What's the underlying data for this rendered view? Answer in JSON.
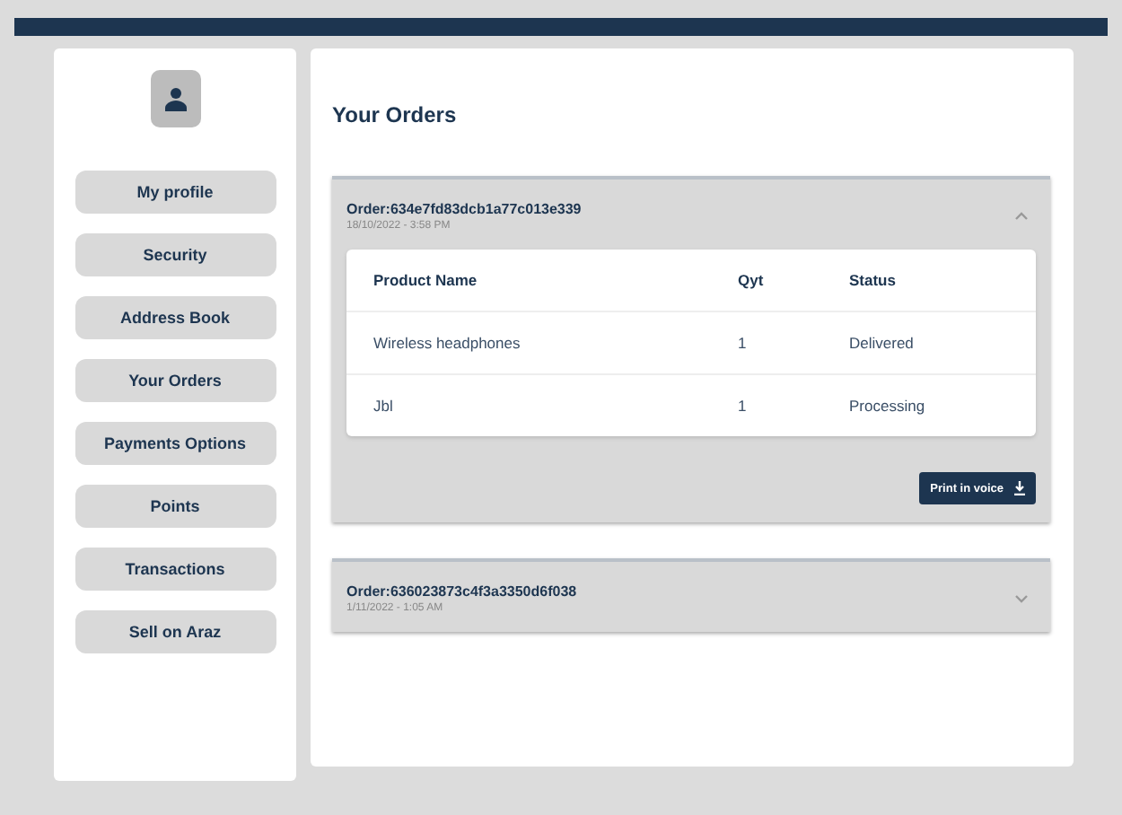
{
  "sidebar": {
    "items": [
      {
        "label": "My profile"
      },
      {
        "label": "Security"
      },
      {
        "label": "Address Book"
      },
      {
        "label": "Your Orders"
      },
      {
        "label": "Payments Options"
      },
      {
        "label": "Points"
      },
      {
        "label": "Transactions"
      },
      {
        "label": "Sell on Araz"
      }
    ]
  },
  "main": {
    "title": "Your Orders",
    "orders": [
      {
        "order": "Order:634e7fd83dcb1a77c013e339",
        "date": "18/10/2022 - 3:58 PM",
        "expanded": true,
        "table": {
          "columns": [
            "Product Name",
            "Qyt",
            "Status"
          ],
          "rows": [
            [
              "Wireless headphones",
              "1",
              "Delivered"
            ],
            [
              "Jbl",
              "1",
              "Processing"
            ]
          ]
        },
        "button": "Print in voice"
      },
      {
        "order": "Order:636023873c4f3a3350d6f038",
        "date": "1/11/2022 - 1:05 AM",
        "expanded": false
      }
    ]
  }
}
